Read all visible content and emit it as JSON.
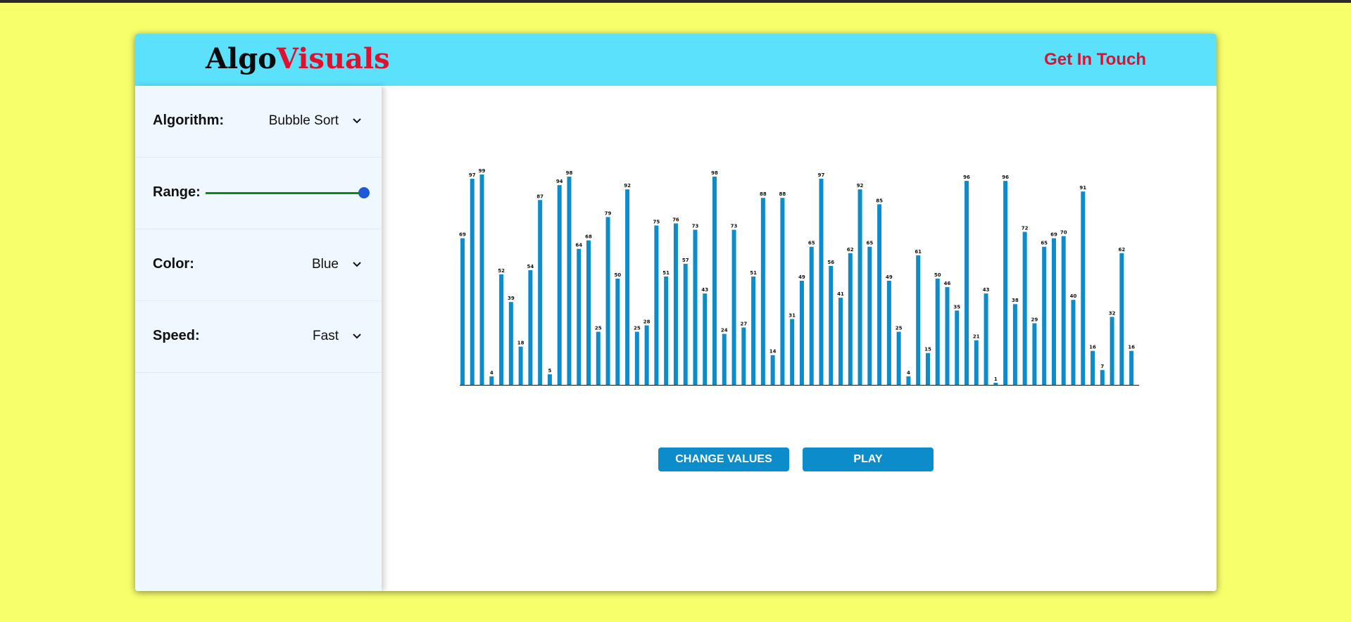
{
  "header": {
    "brand_part1": "Algo",
    "brand_part2": "Visuals",
    "contact_label": "Get In Touch"
  },
  "sidebar": {
    "algorithm": {
      "label": "Algorithm:",
      "value": "Bubble Sort"
    },
    "range": {
      "label": "Range:",
      "value_fraction": 1.0
    },
    "color": {
      "label": "Color:",
      "value": "Blue"
    },
    "speed": {
      "label": "Speed:",
      "value": "Fast"
    }
  },
  "buttons": {
    "change_values": "CHANGE VALUES",
    "play": "PLAY"
  },
  "colors": {
    "background": "#f7ff6b",
    "header": "#5ce1fc",
    "brand_accent": "#e0102e",
    "bar": "#0c8ccb",
    "sidebar": "#eff7ff"
  },
  "chart_data": {
    "type": "bar",
    "title": "",
    "xlabel": "",
    "ylabel": "",
    "ylim": [
      0,
      100
    ],
    "grid": false,
    "values": [
      69,
      97,
      99,
      4,
      52,
      39,
      18,
      54,
      87,
      5,
      94,
      98,
      64,
      68,
      25,
      79,
      50,
      92,
      25,
      28,
      75,
      51,
      76,
      57,
      73,
      43,
      98,
      24,
      73,
      27,
      51,
      88,
      14,
      88,
      31,
      49,
      65,
      97,
      56,
      41,
      62,
      92,
      65,
      85,
      49,
      25,
      4,
      61,
      15,
      50,
      46,
      35,
      96,
      21,
      43,
      1,
      96,
      38,
      72,
      29,
      65,
      69,
      70,
      40,
      91,
      16,
      7,
      32,
      62,
      16
    ]
  }
}
